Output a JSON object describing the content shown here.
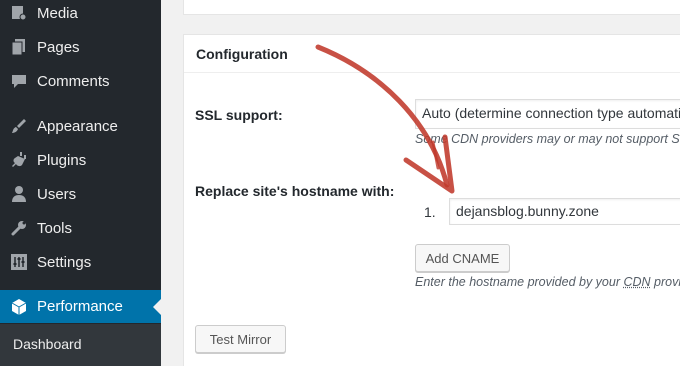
{
  "sidebar": {
    "items": [
      {
        "label": "Media",
        "icon": "media-icon"
      },
      {
        "label": "Pages",
        "icon": "pages-icon"
      },
      {
        "label": "Comments",
        "icon": "comments-icon"
      },
      {
        "label": "Appearance",
        "icon": "appearance-icon"
      },
      {
        "label": "Plugins",
        "icon": "plugins-icon"
      },
      {
        "label": "Users",
        "icon": "users-icon"
      },
      {
        "label": "Tools",
        "icon": "tools-icon"
      },
      {
        "label": "Settings",
        "icon": "settings-icon"
      },
      {
        "label": "Performance",
        "icon": "performance-icon",
        "active": true
      }
    ],
    "submenu": [
      {
        "label": "Dashboard"
      }
    ]
  },
  "config": {
    "title": "Configuration",
    "ssl": {
      "label": "SSL support:",
      "value": "Auto (determine connection type automatically)",
      "description": "Some CDN providers may or may not support SSL"
    },
    "hostname": {
      "label": "Replace site's hostname with:",
      "list_number": "1.",
      "value": "dejansblog.bunny.zone",
      "add_button": "Add CNAME",
      "description_pre": "Enter the hostname provided by your ",
      "description_abbr": "CDN",
      "description_post": " provider"
    },
    "test_button": "Test Mirror"
  },
  "colors": {
    "sidebar_bg": "#23282d",
    "active_bg": "#0073aa",
    "arrow": "#c0392b"
  }
}
